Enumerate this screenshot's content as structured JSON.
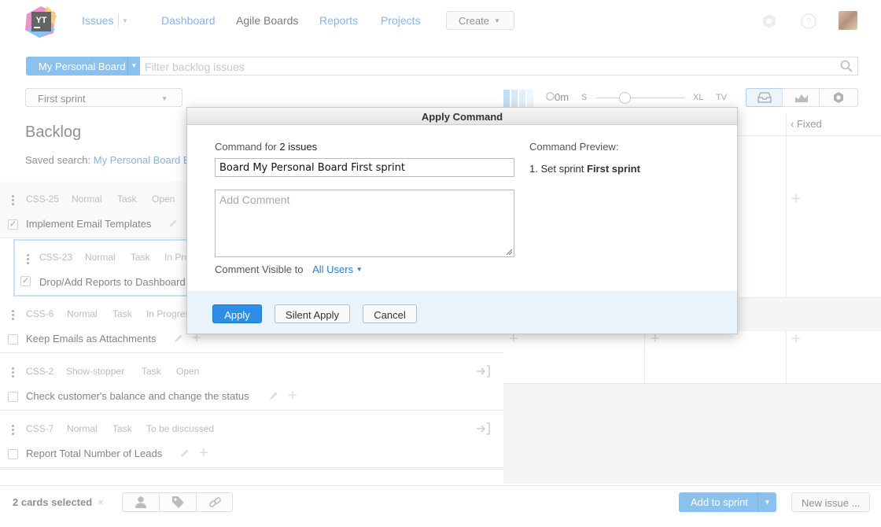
{
  "nav": {
    "logo_text": "YT",
    "issues": "Issues",
    "dashboard": "Dashboard",
    "agile_boards": "Agile Boards",
    "reports": "Reports",
    "projects": "Projects",
    "create": "Create"
  },
  "search": {
    "board_label": "My Personal Board",
    "placeholder": "Filter backlog issues"
  },
  "toolbar": {
    "sprint": "First sprint",
    "clock_label": "0m",
    "size_min": "S",
    "size_xl": "XL",
    "size_tv": "TV"
  },
  "backlog": {
    "title": "Backlog",
    "saved_search_label": "Saved search:",
    "saved_search_link": "My Personal Board B"
  },
  "cards": [
    {
      "id": "CSS-25",
      "priority": "Normal",
      "type": "Task",
      "state": "Open",
      "title": "Implement Email Templates",
      "checked": true
    },
    {
      "id": "CSS-23",
      "priority": "Normal",
      "type": "Task",
      "state": "In Pro",
      "title": "Drop/Add Reports to Dashboard",
      "checked": true
    },
    {
      "id": "CSS-6",
      "priority": "Normal",
      "type": "Task",
      "state": "In Progres",
      "title": "Keep Emails as Attachments",
      "checked": false
    },
    {
      "id": "CSS-2",
      "priority": "Show-stopper",
      "type": "Task",
      "state": "Open",
      "title": "Check customer's balance and change the status",
      "checked": false
    },
    {
      "id": "CSS-7",
      "priority": "Normal",
      "type": "Task",
      "state": "To be discussed",
      "title": "Report Total Number of Leads",
      "checked": false
    }
  ],
  "board": {
    "fixed_column": "Fixed"
  },
  "bottom": {
    "cards_selected": "2 cards selected",
    "close": "×",
    "add_to_sprint": "Add to sprint",
    "new_issue": "New issue ..."
  },
  "dialog": {
    "title": "Apply Command",
    "command_for": "Command for",
    "issue_count": "2 issues",
    "command_value": "Board My Personal Board First sprint",
    "comment_placeholder": "Add Comment",
    "visible_to_label": "Comment Visible to",
    "visible_to_value": "All Users",
    "preview_label": "Command Preview:",
    "preview_prefix": "1. Set sprint",
    "preview_value": "First sprint",
    "apply": "Apply",
    "silent_apply": "Silent Apply",
    "cancel": "Cancel"
  },
  "colors": {
    "accent": "#4da0e6",
    "link": "#4a8ad4",
    "dialog_footer": "#e8f3fb"
  },
  "icons": {
    "logo": "youtrack-logo-icon",
    "settings": "gear-icon",
    "help": "help-icon",
    "search": "search-icon",
    "drag": "drag-handle-icon",
    "edit": "pencil-icon",
    "add": "plus-icon",
    "move": "move-to-board-icon",
    "assignee": "user-icon",
    "tag": "tag-icon",
    "link": "link-icon"
  }
}
